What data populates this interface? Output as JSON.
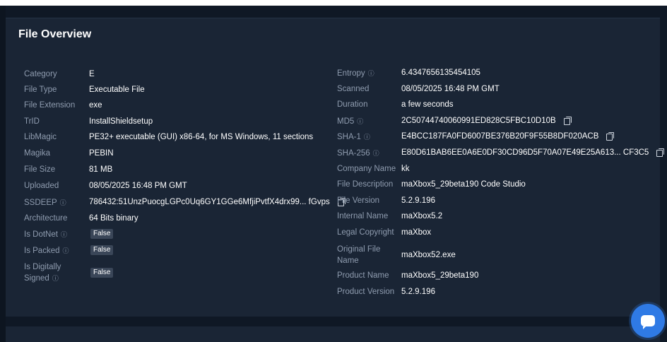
{
  "card": {
    "title": "File Overview"
  },
  "left": [
    {
      "key": "category",
      "label": "Category",
      "value": "E"
    },
    {
      "key": "file-type",
      "label": "File Type",
      "value": "Executable File"
    },
    {
      "key": "file-extension",
      "label": "File Extension",
      "value": "exe"
    },
    {
      "key": "trid",
      "label": "TrID",
      "value": "InstallShieldsetup"
    },
    {
      "key": "libmagic",
      "label": "LibMagic",
      "value": "PE32+ executable (GUI) x86-64, for MS Windows, 11 sections"
    },
    {
      "key": "magika",
      "label": "Magika",
      "value": "PEBIN"
    },
    {
      "key": "file-size",
      "label": "File Size",
      "value": "81 MB"
    },
    {
      "key": "uploaded",
      "label": "Uploaded",
      "value": "08/05/2025 16:48 PM GMT"
    },
    {
      "key": "ssdeep",
      "label": "SSDEEP",
      "value": "786432:51UnzPuocgLGPc0Uq6GY1GGe6MfjiPvtfX4drx99... fGvps"
    },
    {
      "key": "architecture",
      "label": "Architecture",
      "value": "64 Bits binary"
    },
    {
      "key": "is-dotnet",
      "label": "Is DotNet",
      "value": "False"
    },
    {
      "key": "is-packed",
      "label": "Is Packed",
      "value": "False"
    },
    {
      "key": "is-digitally-signed",
      "label_line1": "Is Digitally",
      "label_line2": "Signed",
      "value": "False"
    }
  ],
  "right": [
    {
      "key": "entropy",
      "label": "Entropy",
      "value": "6.4347656135454105"
    },
    {
      "key": "scanned",
      "label": "Scanned",
      "value": "08/05/2025 16:48 PM GMT"
    },
    {
      "key": "duration",
      "label": "Duration",
      "value": "a few seconds"
    },
    {
      "key": "md5",
      "label": "MD5",
      "value": "2C50744740060991ED828C5FBC10D10B"
    },
    {
      "key": "sha1",
      "label": "SHA-1",
      "value": "E4BCC187FA0FD6007BE376B20F9F55B8DF020ACB"
    },
    {
      "key": "sha256",
      "label": "SHA-256",
      "value": "E80D61BAB6EE0A6E0DF30CD96D5F70A07E49E25A613... CF3C5"
    },
    {
      "key": "company-name",
      "label": "Company Name",
      "value": "kk"
    },
    {
      "key": "file-description",
      "label": "File Description",
      "value": "maXbox5_29beta190 Code Studio"
    },
    {
      "key": "file-version",
      "label": "File Version",
      "value": "5.2.9.196"
    },
    {
      "key": "internal-name",
      "label": "Internal Name",
      "value": "maXbox5.2"
    },
    {
      "key": "legal-copyright",
      "label": "Legal Copyright",
      "value": "maXbox"
    },
    {
      "key": "original-file-name",
      "label_line1": "Original File",
      "label_line2": "Name",
      "value": "maXbox52.exe"
    },
    {
      "key": "product-name",
      "label": "Product Name",
      "value": "maXbox5_29beta190"
    },
    {
      "key": "product-version",
      "label": "Product Version",
      "value": "5.2.9.196"
    }
  ],
  "icons": {
    "info": "ⓘ",
    "copy": "copy-icon",
    "chat": "chat-icon"
  },
  "colors": {
    "background": "#0f1825",
    "card": "#1a2535",
    "label": "#8f9caf",
    "value": "#ffffff",
    "badge": "#3a4658",
    "chat_button": "#2f7ae5"
  }
}
